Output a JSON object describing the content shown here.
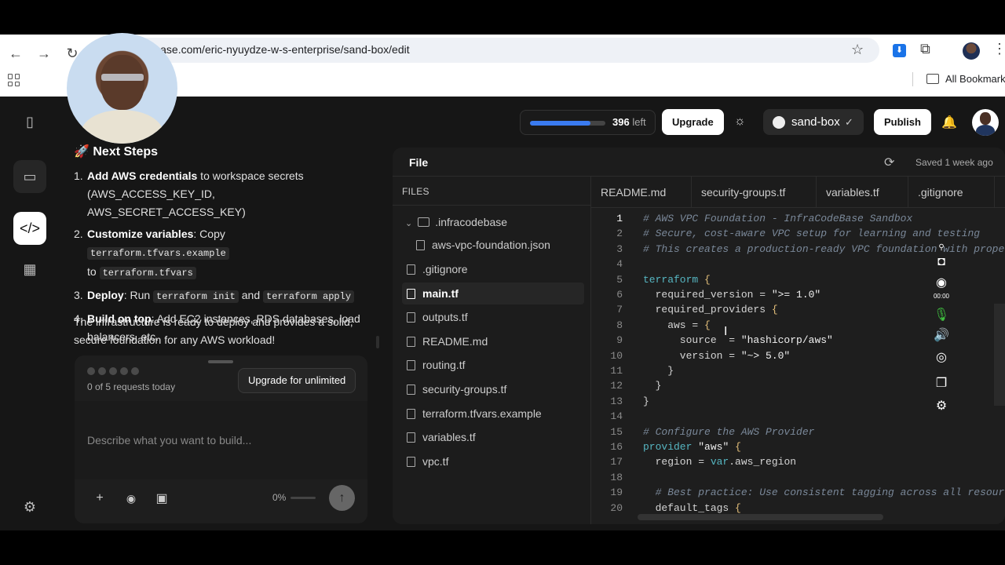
{
  "browser": {
    "url": "codebase.com/eric-nyuydze-w-s-enterprise/sand-box/edit",
    "bookmarks_label": "All Bookmarks"
  },
  "chat": {
    "heading": "Next Steps",
    "steps": [
      {
        "num": "1.",
        "bold": "Add AWS credentials",
        "rest": " to workspace secrets (AWS_ACCESS_KEY_ID, AWS_SECRET_ACCESS_KEY)"
      },
      {
        "num": "2.",
        "bold": "Customize variables",
        "pre": ": Copy ",
        "code1": "terraform.tfvars.example",
        "mid": " to ",
        "code2": "terraform.tfvars"
      },
      {
        "num": "3.",
        "bold": "Deploy",
        "pre": ": Run ",
        "code1": "terraform init",
        "mid": " and ",
        "code2": "terraform apply"
      },
      {
        "num": "4.",
        "bold": "Build on top",
        "rest": ": Add EC2 instances, RDS databases, load balancers, etc."
      }
    ],
    "closing": "The infrastructure is ready to deploy and provides a solid, secure foundation for any AWS workload!"
  },
  "composer": {
    "requests": "0 of 5 requests today",
    "upgrade_unlimited": "Upgrade for unlimited",
    "placeholder": "Describe what you want to build...",
    "percent": "0%"
  },
  "topbar": {
    "credits_num": "396",
    "credits_suffix": "left",
    "credits_fraction": 0.8,
    "upgrade": "Upgrade",
    "repo": "sand-box",
    "publish": "Publish"
  },
  "panel": {
    "title": "File",
    "saved": "Saved 1 week ago",
    "files_header": "FILES",
    "folder": ".infracodebase",
    "folder_file": "aws-vpc-foundation.json",
    "files": [
      ".gitignore",
      "main.tf",
      "outputs.tf",
      "README.md",
      "routing.tf",
      "security-groups.tf",
      "terraform.tfvars.example",
      "variables.tf",
      "vpc.tf"
    ],
    "active_file": "main.tf",
    "tabs": [
      "README.md",
      "security-groups.tf",
      "variables.tf",
      ".gitignore"
    ]
  },
  "recorder": {
    "time": "00:00"
  },
  "code": {
    "lines": [
      "# AWS VPC Foundation - InfraCodeBase Sandbox",
      "# Secure, cost-aware VPC setup for learning and testing",
      "# This creates a production-ready VPC foundation with prope",
      "",
      "terraform {",
      "  required_version = \">= 1.0\"",
      "  required_providers {",
      "    aws = {",
      "      source  = \"hashicorp/aws\"",
      "      version = \"~> 5.0\"",
      "    }",
      "  }",
      "}",
      "",
      "# Configure the AWS Provider",
      "provider \"aws\" {",
      "  region = var.aws_region",
      "",
      "  # Best practice: Use consistent tagging across all resour",
      "  default_tags {"
    ]
  }
}
